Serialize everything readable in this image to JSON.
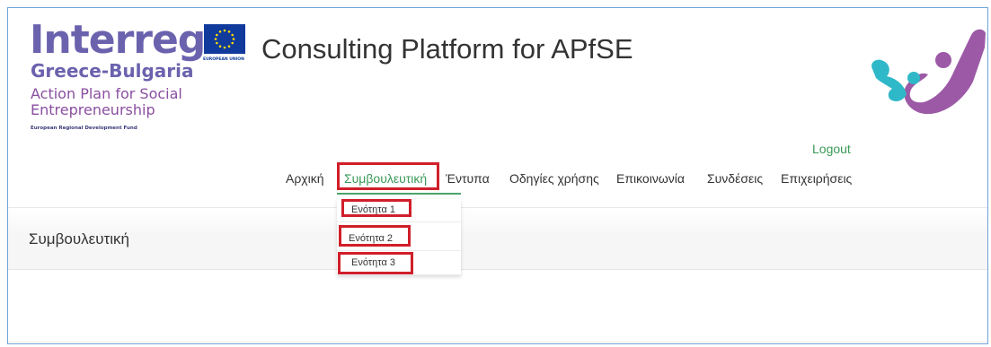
{
  "logo": {
    "interreg": "Interreg",
    "program": "Greece-Bulgaria",
    "project_line1": "Action Plan for Social",
    "project_line2": "Entrepreneurship",
    "fund": "European Regional Development Fund",
    "eu_label": "EUROPEAN UNION",
    "colors": {
      "interreg": "#6b62ae",
      "project": "#8a4fa0",
      "eu_flag": "#103a9c",
      "eu_stars": "#ffdd00"
    }
  },
  "header": {
    "title": "Consulting Platform for APfSE"
  },
  "brand_icon": {
    "name": "apfse-figures-logo",
    "colors": [
      "#2fb8c8",
      "#9c5aa6"
    ]
  },
  "user": {
    "logout_label": "Logout"
  },
  "nav": {
    "items": [
      {
        "label": "Αρχική"
      },
      {
        "label": "Συμβουλευτική"
      },
      {
        "label": "Έντυπα"
      },
      {
        "label": "Οδηγίες χρήσης"
      },
      {
        "label": "Επικοινωνία"
      },
      {
        "label": "Συνδέσεις"
      },
      {
        "label": "Επιχειρήσεις"
      }
    ],
    "active": "Συμβουλευτική",
    "dropdown": [
      {
        "label": "Ενότητα 1"
      },
      {
        "label": "Ενότητα 2"
      },
      {
        "label": "Ενότητα 3"
      }
    ]
  },
  "page": {
    "heading": "Συμβουλευτική"
  },
  "colors": {
    "accent": "#3a9a58",
    "highlight_box": "#d01f2a",
    "frame": "#6fa3d9"
  }
}
